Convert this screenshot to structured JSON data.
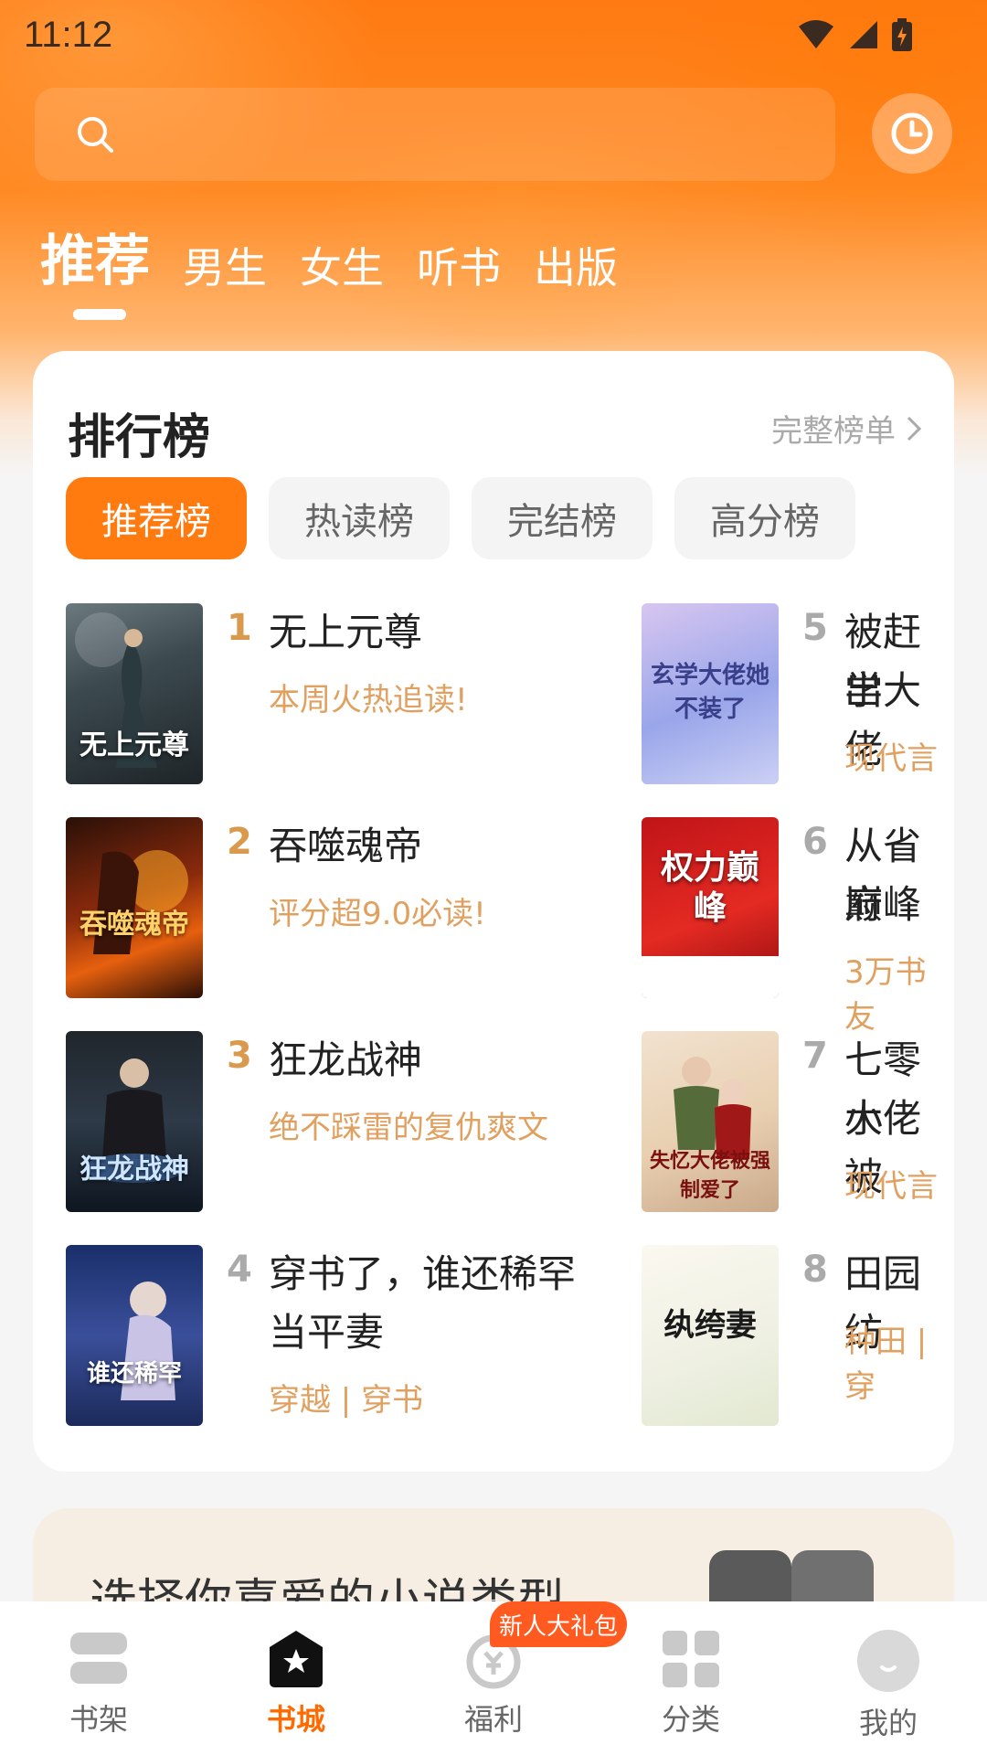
{
  "status": {
    "time": "11:12"
  },
  "header": {
    "tabs": [
      "推荐",
      "男生",
      "女生",
      "听书",
      "出版"
    ]
  },
  "ranking": {
    "title": "排行榜",
    "more": "完整榜单",
    "tabs": [
      "推荐榜",
      "热读榜",
      "完结榜",
      "高分榜"
    ],
    "books": [
      {
        "rank": "1",
        "title": "无上元尊",
        "tag": "本周火热追读!",
        "cover_text": "无上元尊"
      },
      {
        "rank": "2",
        "title": "吞噬魂帝",
        "tag": "评分超9.0必读!",
        "cover_text": "吞噬魂帝"
      },
      {
        "rank": "3",
        "title": "狂龙战神",
        "tag": "绝不踩雷的复仇爽文",
        "cover_text": "狂龙战神"
      },
      {
        "rank": "4",
        "title_line1": "穿书了，谁还稀罕",
        "title_line2": "当平妻",
        "tag": "穿越 | 穿书",
        "cover_text": "谁还稀罕"
      },
      {
        "rank": "5",
        "title_line1": "被赶出",
        "title_line2": "学大佬",
        "tag": "现代言",
        "cover_text": "玄学大佬她不装了"
      },
      {
        "rank": "6",
        "title_line1": "从省府",
        "title_line2": "巅峰",
        "tag": "3万书友",
        "cover_text": "权力巅峰"
      },
      {
        "rank": "7",
        "title_line1": "七零小",
        "title_line2": "大佬被",
        "tag": "现代言",
        "cover_text": "失忆大佬被强制爱了"
      },
      {
        "rank": "8",
        "title": "田园纺",
        "tag": "种田 | 穿",
        "cover_text": "纨绔妻"
      }
    ]
  },
  "genre_banner": {
    "text": "选择你喜爱的小说类型"
  },
  "bottom_nav": {
    "items": [
      "书架",
      "书城",
      "福利",
      "分类",
      "我的"
    ],
    "badge": "新人大礼包"
  },
  "colors": {
    "accent": "#ff7a0f",
    "rank_gold": "#d99a4e",
    "rank_gray": "#aaaaaa"
  }
}
